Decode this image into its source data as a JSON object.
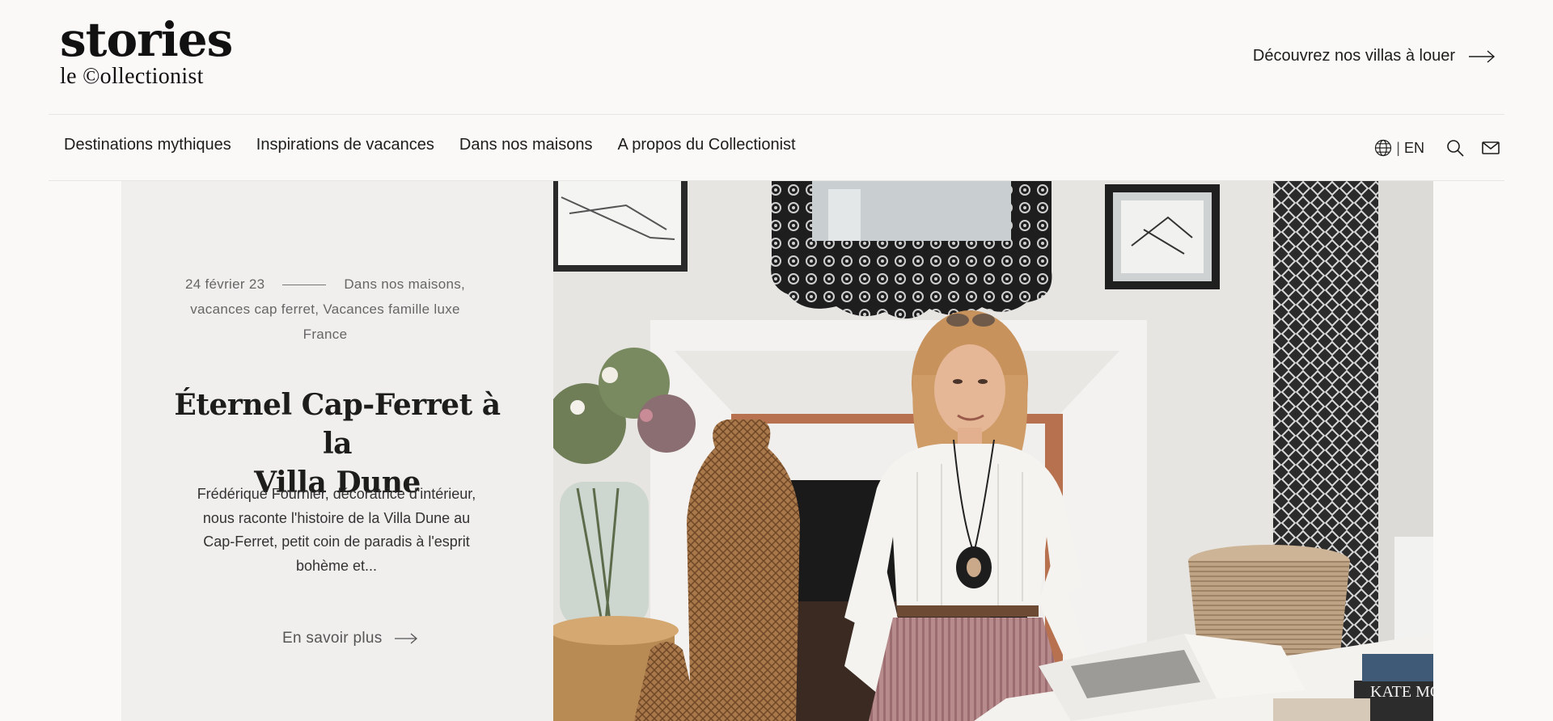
{
  "header": {
    "logo_main": "stories",
    "logo_sub": "le ©ollectionist",
    "cta_label": "Découvrez nos villas à louer"
  },
  "nav": {
    "items": [
      {
        "label": "Destinations mythiques"
      },
      {
        "label": "Inspirations de vacances"
      },
      {
        "label": "Dans nos maisons"
      },
      {
        "label": "A propos du Collectionist"
      }
    ],
    "lang_label": "EN",
    "lang_separator": "|"
  },
  "article": {
    "date": "24 février 23",
    "categories_line1": "Dans nos maisons,",
    "categories_line2": "vacances cap ferret, Vacances famille luxe",
    "categories_line3": "France",
    "title_line1": "Éternel Cap-Ferret à la",
    "title_line2": "Villa Dune",
    "excerpt": "Frédérique Fournier, décoratrice d'intérieur, nous raconte l'histoire de la Villa Dune au Cap-Ferret, petit coin de paradis à l'esprit bohème et...",
    "read_more": "En savoir plus",
    "photo_book_text": "KATE MOSS"
  },
  "icons": {
    "cta_arrow": "arrow-right-icon",
    "globe": "globe-icon",
    "search": "search-icon",
    "mail": "mail-icon",
    "more_arrow": "arrow-right-icon"
  },
  "colors": {
    "background": "#faf9f8",
    "panel": "#f0efed",
    "text": "#1d1d1b",
    "muted": "#666666"
  }
}
